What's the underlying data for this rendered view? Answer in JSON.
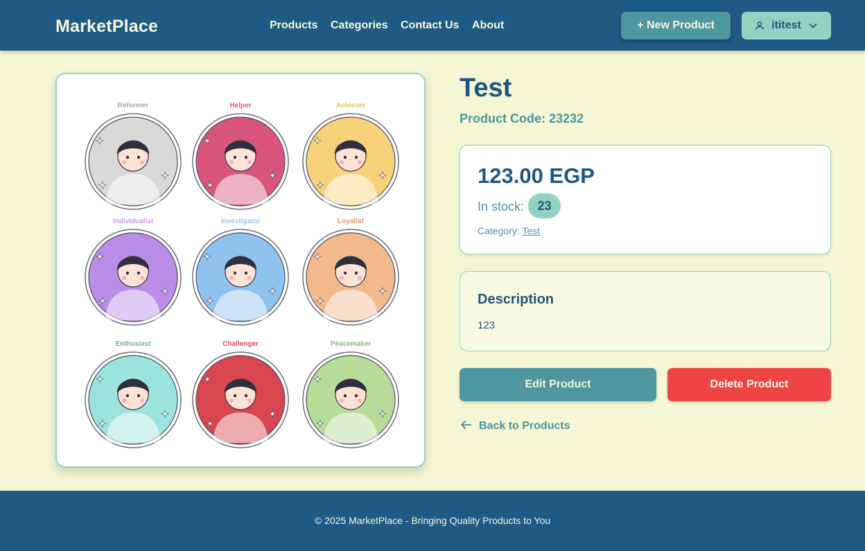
{
  "navbar": {
    "brand": "MarketPlace",
    "links": [
      "Products",
      "Categories",
      "Contact Us",
      "About"
    ],
    "new_product_label": "+ New Product",
    "user_name": "ititest",
    "user_icon": "user-icon",
    "dropdown_icon": "chevron-down-icon"
  },
  "product": {
    "title": "Test",
    "code_label": "Product Code: 23232",
    "price": "123.00 EGP",
    "stock_label": "In stock:",
    "stock_count": "23",
    "category_label": "Category:",
    "category_name": "Test",
    "description_title": "Description",
    "description_text": "123",
    "image": {
      "labels": [
        "Reformer",
        "Helper",
        "Achiever",
        "Individualist",
        "Investigator",
        "Loyalist",
        "Enthusiast",
        "Challenger",
        "Peacemaker"
      ],
      "label_colors": [
        "#a9a9a9",
        "#d9577f",
        "#e8c15a",
        "#c99ae8",
        "#9cc6e8",
        "#e8956a",
        "#6fb59a",
        "#d94e5a",
        "#8cb86a"
      ],
      "circle_colors": [
        "#d9d9d9",
        "#d9557e",
        "#f7d27a",
        "#b98de8",
        "#8fc2ef",
        "#f2b98c",
        "#9be3dd",
        "#d8464f",
        "#b7dc9a"
      ]
    }
  },
  "actions": {
    "edit_label": "Edit Product",
    "delete_label": "Delete Product",
    "back_label": "Back to Products",
    "back_icon": "arrow-left-icon"
  },
  "footer": {
    "text": "© 2025 MarketPlace - Bringing Quality Products to You"
  },
  "colors": {
    "navy": "#1f5a85",
    "teal": "#4e96a0",
    "mint": "#93d1c0",
    "cream": "#f4f6d4",
    "danger": "#ef4444"
  }
}
